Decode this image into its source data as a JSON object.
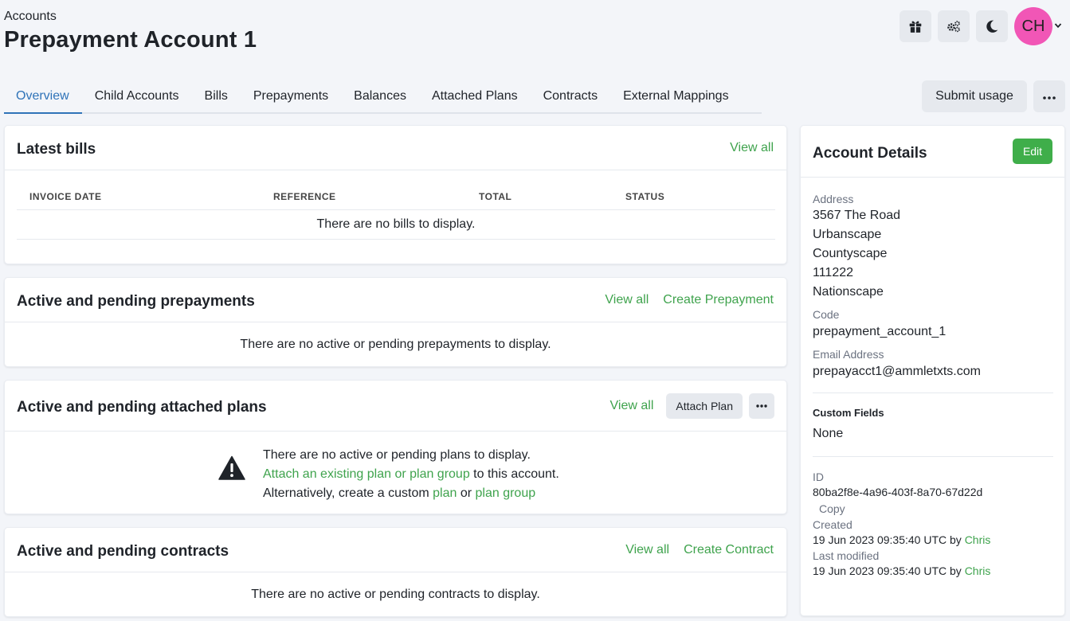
{
  "header": {
    "breadcrumb": "Accounts",
    "title": "Prepayment Account 1",
    "avatar_initials": "CH",
    "icons": [
      "gift-icon",
      "cogs-icon",
      "moon-icon",
      "chevron-down-icon"
    ]
  },
  "tabs": [
    {
      "label": "Overview",
      "active": true
    },
    {
      "label": "Child Accounts"
    },
    {
      "label": "Bills"
    },
    {
      "label": "Prepayments"
    },
    {
      "label": "Balances"
    },
    {
      "label": "Attached Plans"
    },
    {
      "label": "Contracts"
    },
    {
      "label": "External Mappings"
    }
  ],
  "actions": {
    "submit_usage": "Submit usage"
  },
  "bills": {
    "title": "Latest bills",
    "view_all": "View all",
    "columns": [
      "INVOICE DATE",
      "REFERENCE",
      "TOTAL",
      "STATUS"
    ],
    "empty": "There are no bills to display."
  },
  "prepayments": {
    "title": "Active and pending prepayments",
    "view_all": "View all",
    "create": "Create Prepayment",
    "empty": "There are no active or pending prepayments to display."
  },
  "plans": {
    "title": "Active and pending attached plans",
    "view_all": "View all",
    "attach": "Attach Plan",
    "line1": "There are no active or pending plans to display.",
    "attach_link": "Attach an existing plan or plan group",
    "line2_rest": " to this account.",
    "line3_prefix": "Alternatively, create a custom ",
    "plan_link": "plan",
    "or": " or ",
    "plan_group_link": "plan group"
  },
  "contracts": {
    "title": "Active and pending contracts",
    "view_all": "View all",
    "create": "Create Contract",
    "empty": "There are no active or pending contracts to display."
  },
  "details": {
    "title": "Account Details",
    "edit": "Edit",
    "address_label": "Address",
    "address": [
      "3567 The Road",
      "Urbanscape",
      "Countyscape",
      "111222",
      "Nationscape"
    ],
    "code_label": "Code",
    "code": "prepayment_account_1",
    "email_label": "Email Address",
    "email": "prepayacct1@ammletxts.com",
    "custom_fields_label": "Custom Fields",
    "custom_fields": "None",
    "id_label": "ID",
    "id": "80ba2f8e-4a96-403f-8a70-67d22d",
    "copy": "Copy",
    "created_label": "Created",
    "created": "19 Jun 2023 09:35:40 UTC by ",
    "created_by": "Chris",
    "modified_label": "Last modified",
    "modified": "19 Jun 2023 09:35:40 UTC by ",
    "modified_by": "Chris"
  },
  "colors": {
    "accent_green": "#3fa34d",
    "tab_active_blue": "#2f73b8",
    "avatar_pink": "#f156b6",
    "edit_button_green": "#3fae4a"
  }
}
